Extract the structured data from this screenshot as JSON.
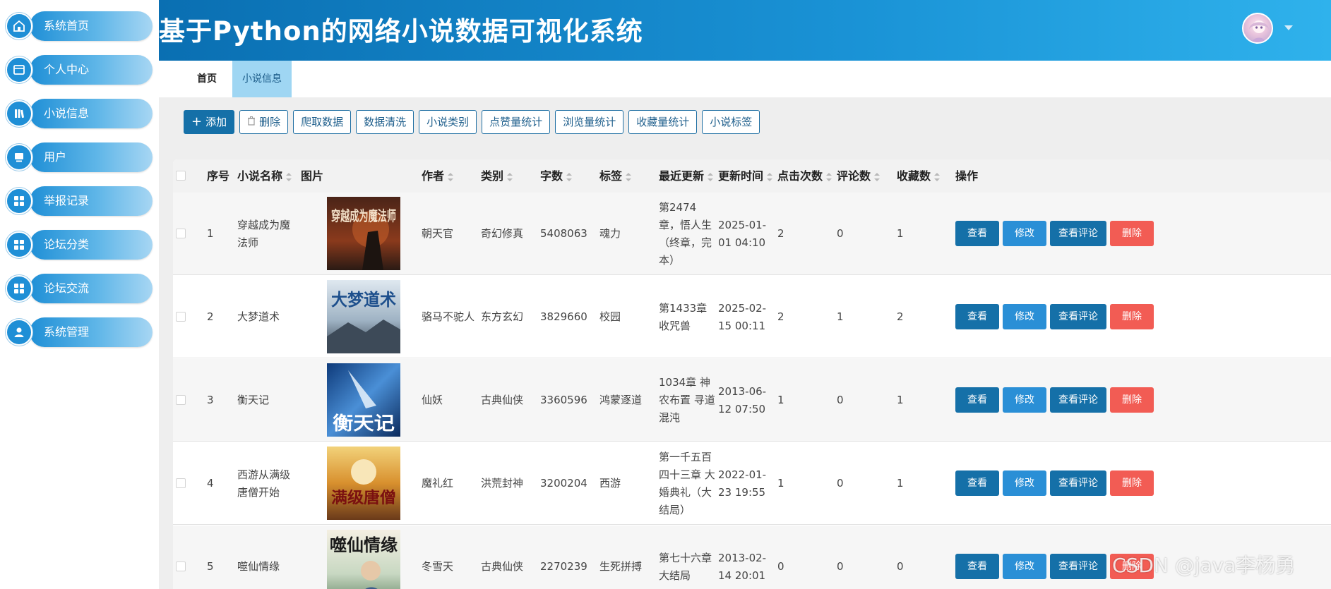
{
  "app": {
    "title": "基于Python的网络小说数据可视化系统"
  },
  "colors": {
    "primary": "#1570a8",
    "accent": "#2a8fd6",
    "danger": "#f25c54",
    "active_tab": "#9fd6f3"
  },
  "sidebar": {
    "items": [
      {
        "label": "系统首页",
        "icon": "home-icon"
      },
      {
        "label": "个人中心",
        "icon": "profile-card-icon"
      },
      {
        "label": "小说信息",
        "icon": "book-icon"
      },
      {
        "label": "用户",
        "icon": "monitor-icon"
      },
      {
        "label": "举报记录",
        "icon": "grid-icon"
      },
      {
        "label": "论坛分类",
        "icon": "grid-icon"
      },
      {
        "label": "论坛交流",
        "icon": "grid-icon"
      },
      {
        "label": "系统管理",
        "icon": "user-icon"
      }
    ]
  },
  "tabs": {
    "home": "首页",
    "current": "小说信息"
  },
  "toolbar": {
    "add": "添加",
    "delete": "删除",
    "crawl": "爬取数据",
    "clean": "数据清洗",
    "category": "小说类别",
    "likes_stats": "点赞量统计",
    "views_stats": "浏览量统计",
    "favorites_stats": "收藏量统计",
    "tags": "小说标签"
  },
  "table": {
    "headers": {
      "index": "序号",
      "name": "小说名称",
      "image": "图片",
      "author": "作者",
      "category": "类别",
      "words": "字数",
      "tag": "标签",
      "latest": "最近更新",
      "update_time": "更新时间",
      "clicks": "点击次数",
      "comments": "评论数",
      "favorites": "收藏数",
      "actions": "操作"
    },
    "actions": {
      "view": "查看",
      "edit": "修改",
      "comments": "查看评论",
      "delete": "删除"
    },
    "rows": [
      {
        "index": "1",
        "name": "穿越成为魔法师",
        "cover_text": "穿越成为魔法师",
        "author": "朝天官",
        "category": "奇幻修真",
        "words": "5408063",
        "tag": "魂力",
        "latest": "第2474章，悟人生（终章，完本）",
        "update_time": "2025-01-01 04:10",
        "clicks": "2",
        "comments": "0",
        "favorites": "1"
      },
      {
        "index": "2",
        "name": "大梦道术",
        "cover_text": "大梦道术",
        "author": "骆马不驼人",
        "category": "东方玄幻",
        "words": "3829660",
        "tag": "校园",
        "latest": "第1433章 收咒兽",
        "update_time": "2025-02-15 00:11",
        "clicks": "2",
        "comments": "1",
        "favorites": "2"
      },
      {
        "index": "3",
        "name": "衡天记",
        "cover_text": "衡天记",
        "author": "仙妖",
        "category": "古典仙侠",
        "words": "3360596",
        "tag": "鸿蒙逐道",
        "latest": "1034章 神农布置 寻道混沌",
        "update_time": "2013-06-12 07:50",
        "clicks": "1",
        "comments": "0",
        "favorites": "1"
      },
      {
        "index": "4",
        "name": "西游从满级唐僧开始",
        "cover_text": "满级唐僧",
        "author": "魔礼红",
        "category": "洪荒封神",
        "words": "3200204",
        "tag": "西游",
        "latest": "第一千五百四十三章 大婚典礼（大结局）",
        "update_time": "2022-01-23 19:55",
        "clicks": "1",
        "comments": "0",
        "favorites": "1"
      },
      {
        "index": "5",
        "name": "噬仙情缘",
        "cover_text": "噬仙情缘",
        "author": "冬雪天",
        "category": "古典仙侠",
        "words": "2270239",
        "tag": "生死拼搏",
        "latest": "第七十六章 大结局",
        "update_time": "2013-02-14 20:01",
        "clicks": "0",
        "comments": "0",
        "favorites": "0"
      }
    ]
  },
  "watermark": "CSDN @java李杨勇"
}
